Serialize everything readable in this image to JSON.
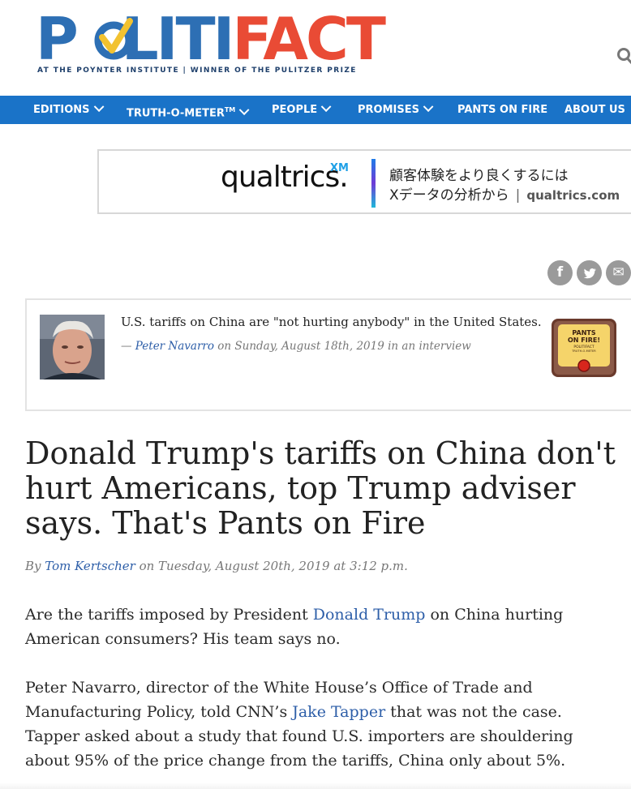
{
  "header": {
    "logo_part1": "P",
    "logo_part2": "LITI",
    "logo_part3": "FACT",
    "tagline": "AT THE POYNTER INSTITUTE  |  WINNER OF THE PULITZER PRIZE"
  },
  "nav": {
    "items": [
      {
        "label": "EDITIONS"
      },
      {
        "label": "TRUTH-O-METER",
        "sup": "TM"
      },
      {
        "label": "PEOPLE"
      },
      {
        "label": "PROMISES"
      },
      {
        "label": "PANTS ON FIRE"
      },
      {
        "label": "ABOUT US"
      }
    ]
  },
  "ad": {
    "brand": "qualtrics.",
    "brand_suffix": "XM",
    "line1": "顧客体験をより良くするには",
    "line2": "Xデータの分析から",
    "separator": "|",
    "domain": "qualtrics.com"
  },
  "share": {
    "facebook_glyph": "f",
    "twitter_glyph": "t",
    "email_glyph": "✉"
  },
  "claim": {
    "text": "U.S. tariffs on China are \"not hurting anybody\" in the United States.",
    "dash": "— ",
    "speaker": "Peter Navarro",
    "context": " on Sunday, August 18th, 2019 in an interview",
    "rating_line1": "PANTS",
    "rating_line2": "ON FIRE!",
    "rating_small1": "POLITIFACT",
    "rating_small2": "TRUTH-O-METER"
  },
  "article": {
    "headline": "Donald Trump's tariffs on China don't hurt Americans, top Trump adviser says. That's Pants on Fire",
    "byline_prefix": "By ",
    "author": "Tom Kertscher",
    "byline_date": " on Tuesday, August 20th, 2019 at 3:12 p.m.",
    "p1_a": "Are the tariffs imposed by President ",
    "p1_link": "Donald Trump",
    "p1_b": " on China hurting American consumers? His team says no.",
    "p2_a": "Peter Navarro, director of the White House’s Office of Trade and Manufacturing Policy, told CNN’s ",
    "p2_link": "Jake Tapper",
    "p2_b": " that was not the case. Tapper asked about a study that found U.S. importers are shouldering about 95% of the price change from the tariffs, China only about 5%."
  },
  "colors": {
    "brand_blue": "#2d6fb4",
    "brand_orange": "#e94b35",
    "nav_blue": "#1a73c8",
    "link_blue": "#2d5ea8"
  }
}
